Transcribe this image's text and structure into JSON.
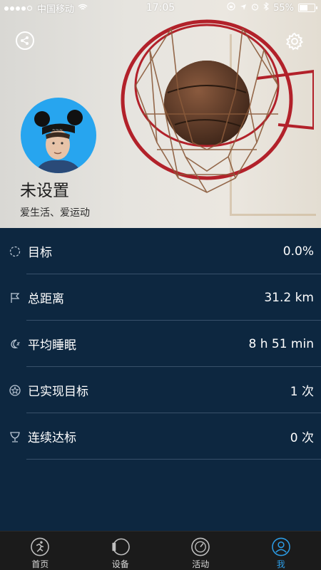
{
  "status_bar": {
    "carrier": "中国移动",
    "time": "17:05",
    "battery": "55%",
    "battery_level": 0.55
  },
  "header": {
    "share_icon": "share-icon",
    "settings_icon": "gear-icon"
  },
  "profile": {
    "name": "未设置",
    "motto": "爱生活、爱运动"
  },
  "stats": [
    {
      "icon": "target-icon",
      "label": "目标",
      "value": "0.0%"
    },
    {
      "icon": "flag-icon",
      "label": "总距离",
      "value": "31.2 km"
    },
    {
      "icon": "sleep-moon-icon",
      "label": "平均睡眠",
      "value": "8 h 51 min"
    },
    {
      "icon": "star-badge-icon",
      "label": "已实现目标",
      "value": "1 次"
    },
    {
      "icon": "trophy-icon",
      "label": "连续达标",
      "value": "0 次"
    }
  ],
  "tabs": [
    {
      "icon": "runner-icon",
      "label": "首页",
      "active": false
    },
    {
      "icon": "device-icon",
      "label": "设备",
      "active": false
    },
    {
      "icon": "activity-gauge-icon",
      "label": "活动",
      "active": false
    },
    {
      "icon": "user-icon",
      "label": "我",
      "active": true
    }
  ],
  "colors": {
    "panel_bg": "#0d2740",
    "divider": "#38506a",
    "accent": "#2c9be3",
    "avatar_bg": "#27a5ef",
    "tabbar_bg": "#1b1b1b"
  }
}
